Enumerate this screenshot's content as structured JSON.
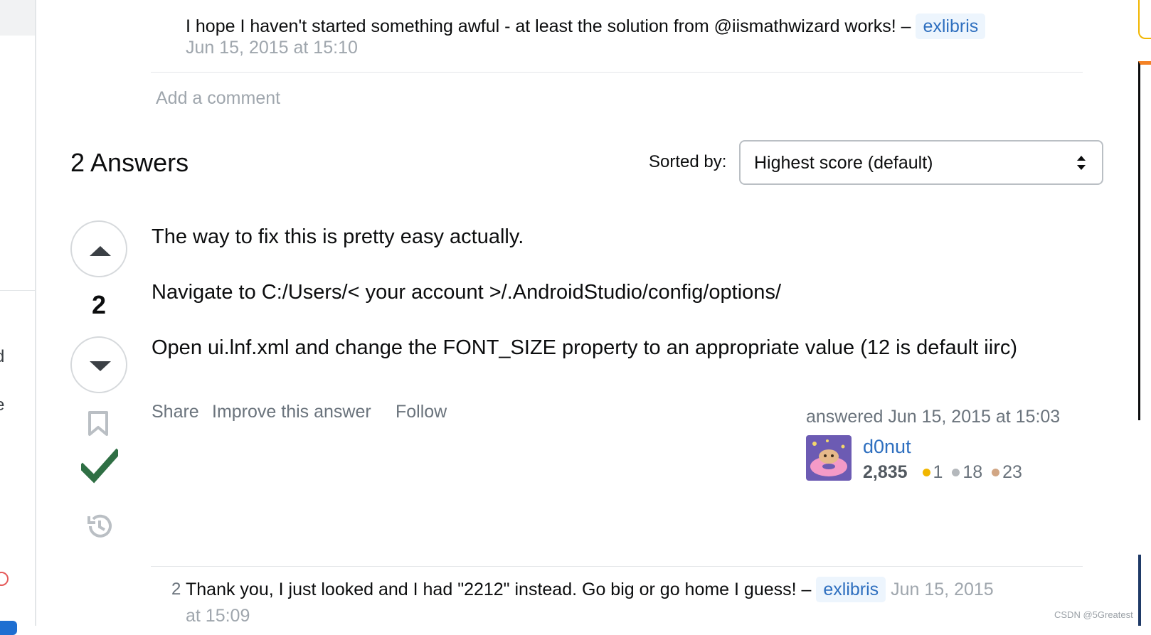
{
  "comment_top": {
    "text": "I hope I haven't started something awful - at least the solution from @iismathwizard works! –",
    "user": "exlibris",
    "date": "Jun 15, 2015 at 15:10"
  },
  "add_comment_label": "Add a comment",
  "answers": {
    "title": "2 Answers",
    "sort_label": "Sorted by:",
    "sort_value": "Highest score (default)"
  },
  "answer": {
    "score": "2",
    "paragraphs": [
      "The way to fix this is pretty easy actually.",
      "Navigate to C:/Users/< your account >/.AndroidStudio/config/options/",
      "Open ui.lnf.xml and change the FONT_SIZE property to an appropriate value (12 is default iirc)"
    ],
    "menu": {
      "share": "Share",
      "improve": "Improve this answer",
      "follow": "Follow"
    },
    "answered": "answered Jun 15, 2015 at 15:03",
    "user": {
      "name": "d0nut",
      "reputation": "2,835",
      "gold": "1",
      "silver": "18",
      "bronze": "23"
    }
  },
  "comment_bottom": {
    "score": "2",
    "text": "Thank you, I just looked and I had \"2212\" instead. Go big or go home I guess! –",
    "user": "exlibris",
    "date_part1": "Jun 15, 2015",
    "date_part2": "at 15:09"
  },
  "sidebar_fragments": [
    "d",
    "e"
  ],
  "watermark": "CSDN @5Greatest",
  "colors": {
    "link": "#2e6fbf",
    "accepted": "#2f6f44",
    "gold": "#f1b600",
    "silver": "#b4b8bc",
    "bronze": "#d1a684"
  },
  "icons": [
    "vote-up-icon",
    "vote-down-icon",
    "bookmark-icon",
    "accepted-check-icon",
    "history-icon",
    "sort-arrows-icon"
  ]
}
